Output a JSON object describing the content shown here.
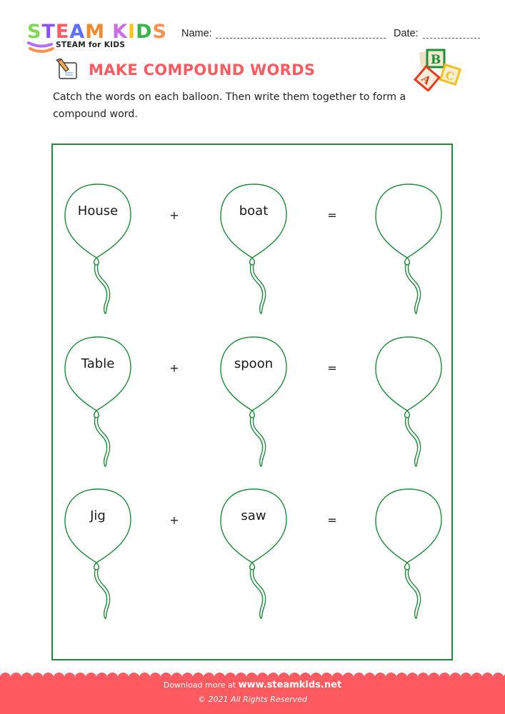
{
  "logo": {
    "letters": [
      {
        "char": "S",
        "color": "#7ed957"
      },
      {
        "char": "T",
        "color": "#8c52ff"
      },
      {
        "char": "E",
        "color": "#ff5a5f"
      },
      {
        "char": "A",
        "color": "#5e6fff"
      },
      {
        "char": "M",
        "color": "#f08a2c"
      },
      {
        "char": " ",
        "color": "#ffffff"
      },
      {
        "char": "K",
        "color": "#cb6ce6"
      },
      {
        "char": "I",
        "color": "#ffc20e"
      },
      {
        "char": "D",
        "color": "#38b44a"
      },
      {
        "char": "S",
        "color": "#ff914d"
      }
    ],
    "tagline": "STEAM for KIDS"
  },
  "header": {
    "name_label": "Name:",
    "date_label": "Date:"
  },
  "worksheet": {
    "title": "MAKE COMPOUND WORDS",
    "title_color": "#ff5a5f",
    "instructions": "Catch the words on each balloon. Then write them together to form a compound word.",
    "frame_color": "#1e8a3a",
    "rows": [
      {
        "first": "House",
        "plus": "+",
        "second": "boat",
        "equals": "=",
        "answer": ""
      },
      {
        "first": "Table",
        "plus": "+",
        "second": "spoon",
        "equals": "=",
        "answer": ""
      },
      {
        "first": "Jig",
        "plus": "+",
        "second": "saw",
        "equals": "=",
        "answer": ""
      }
    ]
  },
  "blocks": {
    "letters": [
      "B",
      "A",
      "C"
    ]
  },
  "footer": {
    "download_prefix": "Download more at",
    "site": "www.steamkids.net",
    "copyright": "© 2021 All Rights Reserved",
    "color": "#ff5a5f"
  }
}
